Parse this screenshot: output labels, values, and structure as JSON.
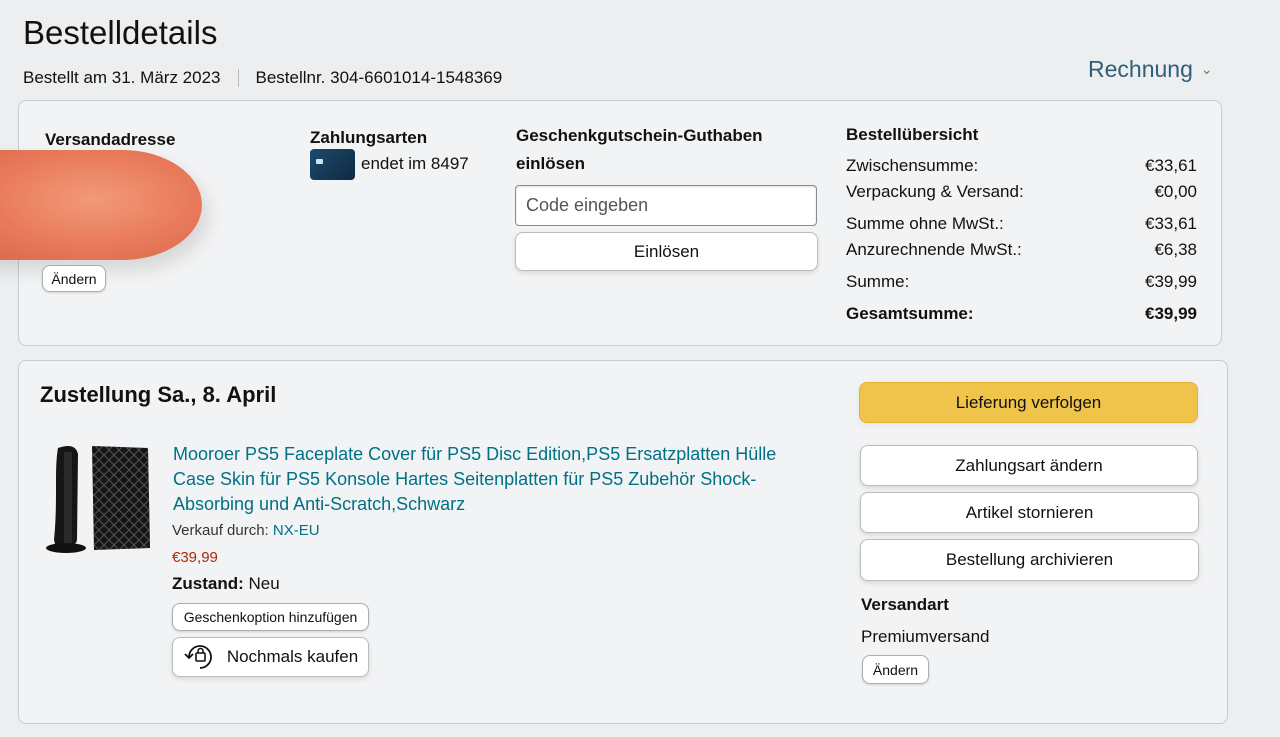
{
  "header": {
    "title": "Bestelldetails",
    "order_date": "Bestellt am 31. März 2023",
    "order_number": "Bestellnr. 304-6601014-1548369",
    "invoice_label": "Rechnung",
    "invoice_icon": "chevron-down-icon"
  },
  "summary_box": {
    "shipping_address_label": "Versandadresse",
    "change_address_label": "Ändern",
    "payment_label": "Zahlungsarten",
    "card_text": "endet im 8497",
    "gift_card": {
      "label_line1": "Geschenkgutschein-Guthaben",
      "label_line2": "einlösen",
      "input_placeholder": "Code eingeben",
      "redeem_label": "Einlösen"
    },
    "order_summary": {
      "title": "Bestellübersicht",
      "rows": [
        {
          "label": "Zwischensumme:",
          "value": "€33,61"
        },
        {
          "label": "Verpackung & Versand:",
          "value": "€0,00"
        },
        {
          "label": "Summe ohne MwSt.:",
          "value": "€33,61"
        },
        {
          "label": "Anzurechnende MwSt.:",
          "value": "€6,38"
        },
        {
          "label": "Summe:",
          "value": "€39,99"
        },
        {
          "label": "Gesamtsumme:",
          "value": "€39,99"
        }
      ]
    }
  },
  "delivery": {
    "title": "Zustellung Sa., 8. April",
    "product_title": "Mooroer PS5 Faceplate Cover für PS5 Disc Edition,PS5 Ersatzplatten Hülle Case Skin für PS5 Konsole Hartes Seitenplatten für PS5 Zubehör Shock-Absorbing und Anti-Scratch,Schwarz",
    "sold_by_label": "Verkauf durch:",
    "seller": "NX-EU",
    "price": "€39,99",
    "condition_label": "Zustand:",
    "condition_value": "Neu",
    "gift_option_label": "Geschenkoption hinzufügen",
    "buy_again_label": "Nochmals kaufen",
    "actions": {
      "track": "Lieferung verfolgen",
      "change_payment": "Zahlungsart ändern",
      "cancel": "Artikel stornieren",
      "archive": "Bestellung archivieren"
    },
    "shipping_method_label": "Versandart",
    "shipping_method_value": "Premiumversand",
    "change_shipping_label": "Ändern"
  },
  "colors": {
    "link": "#007185",
    "price": "#b12704",
    "primary_button": "#f0c44a"
  }
}
